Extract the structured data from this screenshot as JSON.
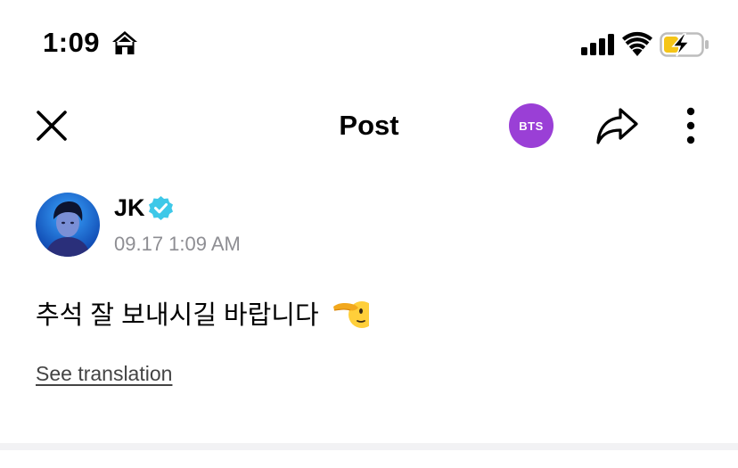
{
  "status_bar": {
    "time": "1:09",
    "battery_color": "#f5c518"
  },
  "nav": {
    "title": "Post",
    "badge_label": "BTS",
    "badge_color": "#9a3fd6",
    "icons": [
      "close-icon",
      "share-icon",
      "more-vertical-icon"
    ]
  },
  "post": {
    "author": "JK",
    "verified_color": "#3ec8e8",
    "timestamp": "09.17 1:09 AM",
    "text": "추석 잘 보내시길 바랍니다",
    "emoji": "salute-face-emoji",
    "translate_label": "See translation"
  }
}
